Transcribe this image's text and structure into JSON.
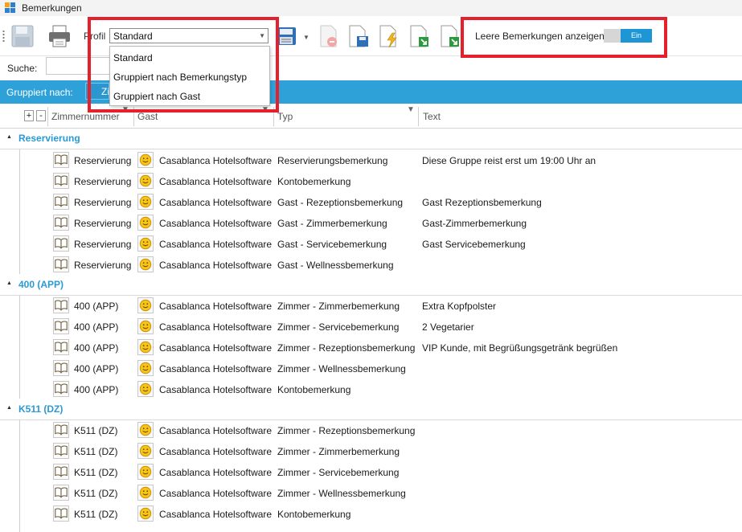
{
  "window": {
    "title": "Bemerkungen"
  },
  "toolbar": {
    "profil_label": "Profil",
    "profil_value": "Standard",
    "profil_options": [
      "Standard",
      "Gruppiert nach Bemerkungstyp",
      "Gruppiert nach Gast"
    ],
    "leere_label": "Leere Bemerkungen anzeigen",
    "toggle_text": "Ein"
  },
  "search": {
    "label": "Suche:",
    "value": ""
  },
  "groupbar": {
    "label": "Gruppiert nach:",
    "chip": "Zi"
  },
  "columns": {
    "zimmer": "Zimmernummer",
    "gast": "Gast",
    "typ": "Typ",
    "text": "Text"
  },
  "groups": [
    {
      "label": "Reservierung",
      "rows": [
        {
          "zimmer": "Reservierung",
          "gast": "Casablanca Hotelsoftware",
          "typ": "Reservierungsbemerkung",
          "text": "Diese Gruppe reist erst um 19:00 Uhr an"
        },
        {
          "zimmer": "Reservierung",
          "gast": "Casablanca Hotelsoftware",
          "typ": "Kontobemerkung",
          "text": ""
        },
        {
          "zimmer": "Reservierung",
          "gast": "Casablanca Hotelsoftware",
          "typ": "Gast - Rezeptionsbemerkung",
          "text": "Gast Rezeptionsbemerkung"
        },
        {
          "zimmer": "Reservierung",
          "gast": "Casablanca Hotelsoftware",
          "typ": "Gast - Zimmerbemerkung",
          "text": "Gast-Zimmerbemerkung"
        },
        {
          "zimmer": "Reservierung",
          "gast": "Casablanca Hotelsoftware",
          "typ": "Gast - Servicebemerkung",
          "text": "Gast Servicebemerkung"
        },
        {
          "zimmer": "Reservierung",
          "gast": "Casablanca Hotelsoftware",
          "typ": "Gast - Wellnessbemerkung",
          "text": ""
        }
      ]
    },
    {
      "label": "400 (APP)",
      "rows": [
        {
          "zimmer": "400 (APP)",
          "gast": "Casablanca Hotelsoftware",
          "typ": "Zimmer - Zimmerbemerkung",
          "text": "Extra Kopfpolster"
        },
        {
          "zimmer": "400 (APP)",
          "gast": "Casablanca Hotelsoftware",
          "typ": "Zimmer - Servicebemerkung",
          "text": "2 Vegetarier"
        },
        {
          "zimmer": "400 (APP)",
          "gast": "Casablanca Hotelsoftware",
          "typ": "Zimmer - Rezeptionsbemerkung",
          "text": "VIP Kunde, mit Begrüßungsgetränk begrüßen"
        },
        {
          "zimmer": "400 (APP)",
          "gast": "Casablanca Hotelsoftware",
          "typ": "Zimmer - Wellnessbemerkung",
          "text": ""
        },
        {
          "zimmer": "400 (APP)",
          "gast": "Casablanca Hotelsoftware",
          "typ": "Kontobemerkung",
          "text": ""
        }
      ]
    },
    {
      "label": "K511 (DZ)",
      "rows": [
        {
          "zimmer": "K511 (DZ)",
          "gast": "Casablanca Hotelsoftware",
          "typ": "Zimmer - Rezeptionsbemerkung",
          "text": ""
        },
        {
          "zimmer": "K511 (DZ)",
          "gast": "Casablanca Hotelsoftware",
          "typ": "Zimmer - Zimmerbemerkung",
          "text": ""
        },
        {
          "zimmer": "K511 (DZ)",
          "gast": "Casablanca Hotelsoftware",
          "typ": "Zimmer - Servicebemerkung",
          "text": ""
        },
        {
          "zimmer": "K511 (DZ)",
          "gast": "Casablanca Hotelsoftware",
          "typ": "Zimmer - Wellnessbemerkung",
          "text": ""
        },
        {
          "zimmer": "K511 (DZ)",
          "gast": "Casablanca Hotelsoftware",
          "typ": "Kontobemerkung",
          "text": ""
        }
      ]
    }
  ],
  "colors": {
    "accent": "#2ea1d8",
    "group_label": "#2a9ad4",
    "highlight": "#e3202b",
    "toggle_on": "#1e96d6"
  }
}
